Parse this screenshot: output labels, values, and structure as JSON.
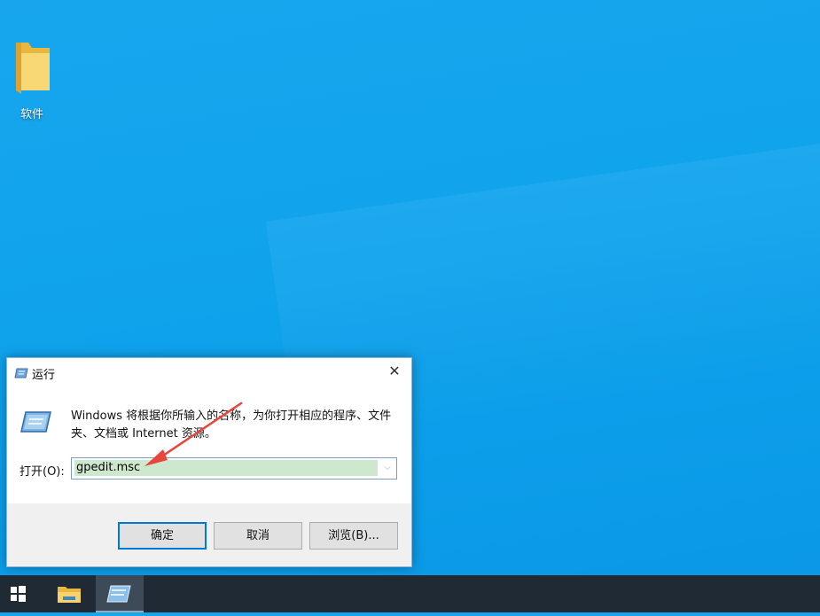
{
  "desktop": {
    "icons": [
      {
        "label": "软件",
        "icon": "folder-icon"
      }
    ]
  },
  "dialog": {
    "title": "运行",
    "close_glyph": "✕",
    "description": "Windows 将根据你所输入的名称，为你打开相应的程序、文件夹、文档或 Internet 资源。",
    "open_label": "打开(O):",
    "open_value": "gpedit.msc",
    "buttons": {
      "ok": "确定",
      "cancel": "取消",
      "browse": "浏览(B)..."
    }
  },
  "annotation": {
    "color": "#e8453c",
    "icon": "red-arrow"
  },
  "taskbar": {
    "items": [
      {
        "icon": "windows-start-icon"
      },
      {
        "icon": "file-explorer-icon"
      },
      {
        "icon": "run-app-icon",
        "active": true
      }
    ],
    "background": "#1f2a35"
  }
}
